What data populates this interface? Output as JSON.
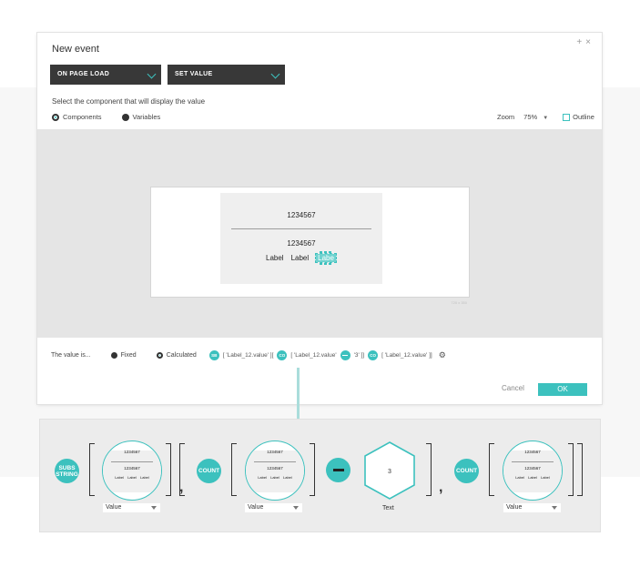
{
  "dialog": {
    "title": "New event",
    "add_icon": "plus-icon",
    "close_icon": "close-icon",
    "event_select": "ON PAGE LOAD",
    "action_select": "SET VALUE",
    "prompt": "Select the component that will display the value",
    "source_options": [
      {
        "label": "Components",
        "selected": true
      },
      {
        "label": "Variables",
        "selected": false
      }
    ],
    "zoom_label": "Zoom",
    "zoom_value": "75%",
    "outline_label": "Outline",
    "outline_checked": false
  },
  "preview": {
    "value_top": "1234567",
    "value_bottom": "1234567",
    "labels": [
      "Label",
      "Label",
      "Labe"
    ],
    "artboard_size": "720 x 350"
  },
  "value_row": {
    "label": "The value is...",
    "options": [
      {
        "label": "Fixed",
        "selected": false
      },
      {
        "label": "Calculated",
        "selected": true
      }
    ],
    "expression": [
      {
        "type": "token",
        "text": "SB"
      },
      {
        "type": "text",
        "text": "[ 'Label_12.value' ]["
      },
      {
        "type": "token",
        "text": "CO"
      },
      {
        "type": "text",
        "text": "[ 'Label_12.value'"
      },
      {
        "type": "minus"
      },
      {
        "type": "text",
        "text": "'3' ]]"
      },
      {
        "type": "token",
        "text": "CO"
      },
      {
        "type": "text",
        "text": "[ 'Label_12.value' ]]"
      }
    ],
    "settings_icon": "gear-icon"
  },
  "actions": {
    "cancel": "Cancel",
    "ok": "OK"
  },
  "formula": {
    "substring_token": "SUBS STRING",
    "count_token_1": "COUNT",
    "count_token_2": "COUNT",
    "mini_value": "1234567",
    "mini_labels": "Label Label Label",
    "dropdown_1": "Value",
    "dropdown_2": "Value",
    "dropdown_3": "Value",
    "hex_value": "3",
    "hex_label": "Text",
    "comma": ","
  },
  "colors": {
    "accent": "#3cc1be",
    "dark_select": "#383838",
    "canvas": "#e5e5e5",
    "formula_bg": "#ececec"
  }
}
